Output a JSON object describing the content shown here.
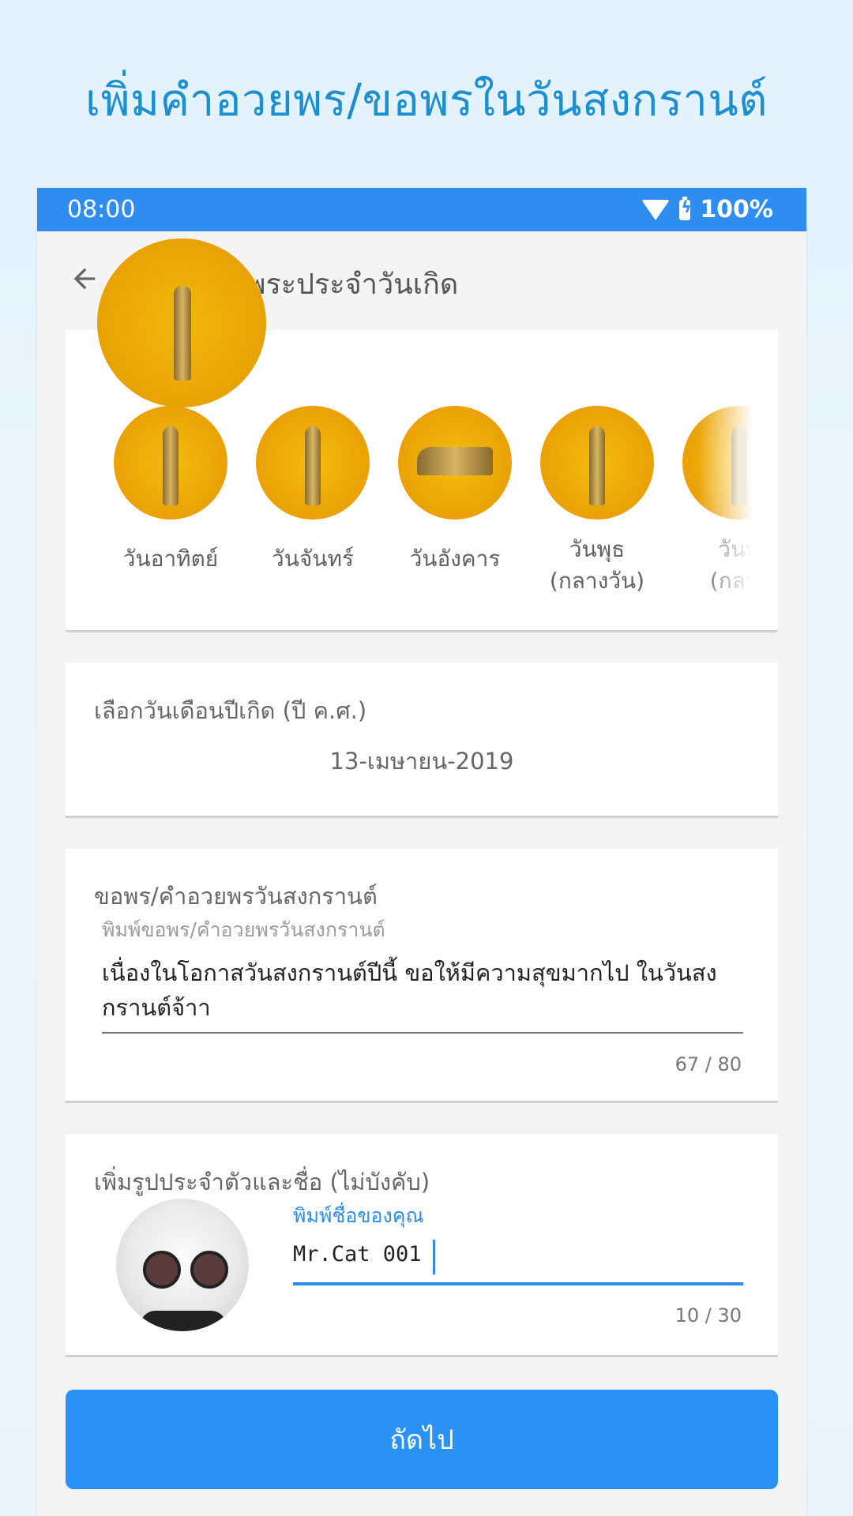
{
  "promo": {
    "title": "เพิ่มคำอวยพร/ขอพรในวันสงกรานต์"
  },
  "status_bar": {
    "time": "08:00",
    "battery": "100%",
    "icons": [
      "wifi-icon",
      "battery-charging-icon"
    ]
  },
  "app_bar": {
    "back_icon": "arrow-left-icon",
    "title": "สรงน้ำพระประจำวันเกิด"
  },
  "buddha_days": [
    {
      "label": "วันอาทิตย์",
      "pose": "standing"
    },
    {
      "label": "วันจันทร์",
      "pose": "standing"
    },
    {
      "label": "วันอังคาร",
      "pose": "reclining"
    },
    {
      "label": "วันพุธ\n(กลางวัน)",
      "pose": "standing"
    },
    {
      "label": "วันพุ\n(กลาง",
      "pose": "standing"
    }
  ],
  "birth_date": {
    "label": "เลือกวันเดือนปีเกิด (ปี ค.ศ.)",
    "value": "13-เมษายน-2019"
  },
  "wish": {
    "label": "ขอพร/คำอวยพรวันสงกรานต์",
    "hint": "พิมพ์ขอพร/คำอวยพรวันสงกรานต์",
    "value": "เนื่องในโอกาสวันสงกรานต์ปีนี้ ขอให้มีความสุขมากไป ในวันสงกรานต์จ้าา",
    "counter": "67 / 80"
  },
  "profile": {
    "label": "เพิ่มรูปประจำตัวและชื่อ (ไม่บังคับ)",
    "name_hint": "พิมพ์ชื่อของคุณ",
    "name_value": "Mr.Cat 001",
    "counter": "10 / 30"
  },
  "next_button": {
    "label": "ถัดไป"
  },
  "colors": {
    "primary": "#2a92f4",
    "status_bar": "#2f8cf0",
    "promo_title": "#1b8fd0",
    "gold": "#f4bd0c"
  }
}
